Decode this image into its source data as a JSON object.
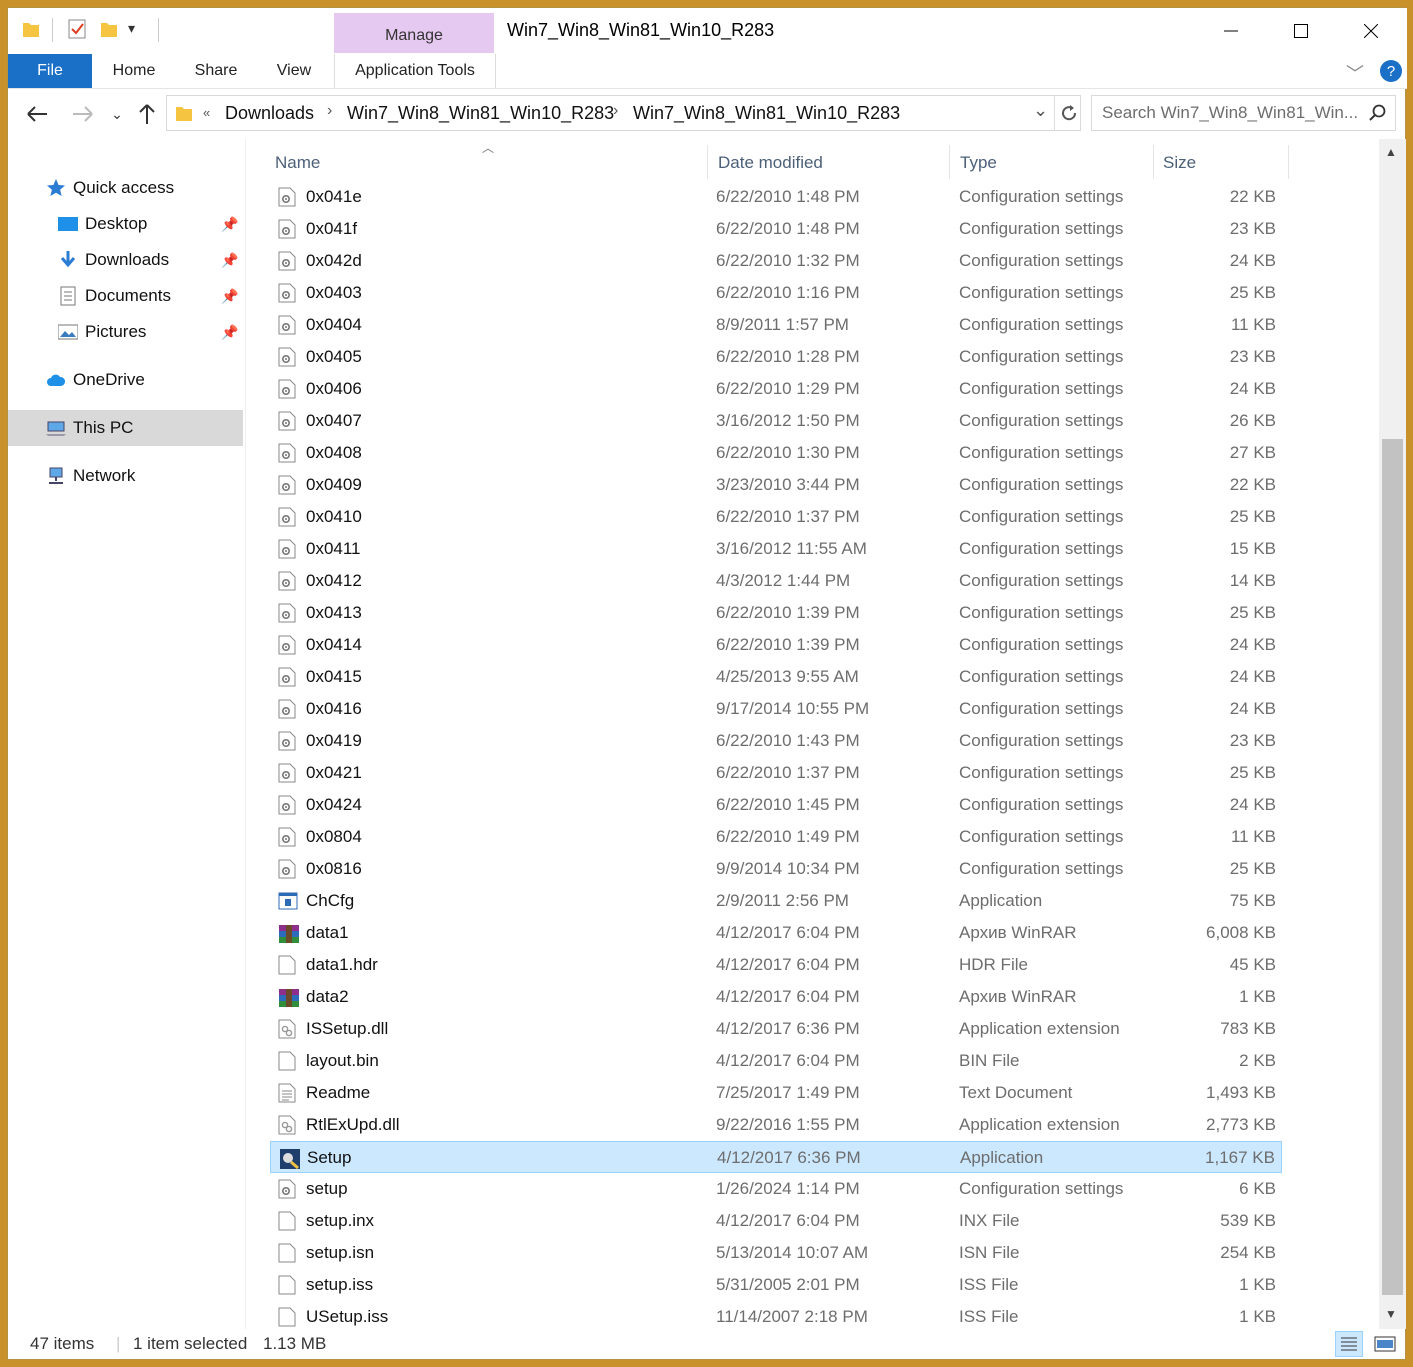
{
  "window": {
    "title": "Win7_Win8_Win81_Win10_R283",
    "manage_label": "Manage"
  },
  "ribbon": {
    "tabs": [
      "File",
      "Home",
      "Share",
      "View",
      "Application Tools"
    ]
  },
  "address": {
    "crumbs": [
      "Downloads",
      "Win7_Win8_Win81_Win10_R283",
      "Win7_Win8_Win81_Win10_R283"
    ],
    "overflow": "«"
  },
  "search": {
    "placeholder": "Search Win7_Win8_Win81_Win..."
  },
  "nav": {
    "quick_access": "Quick access",
    "pinned": [
      "Desktop",
      "Downloads",
      "Documents",
      "Pictures"
    ],
    "onedrive": "OneDrive",
    "thispc": "This PC",
    "network": "Network"
  },
  "columns": {
    "name": "Name",
    "date": "Date modified",
    "type": "Type",
    "size": "Size"
  },
  "files": [
    {
      "name": "0x041e",
      "date": "6/22/2010 1:48 PM",
      "type": "Configuration settings",
      "size": "22 KB",
      "icon": "config"
    },
    {
      "name": "0x041f",
      "date": "6/22/2010 1:48 PM",
      "type": "Configuration settings",
      "size": "23 KB",
      "icon": "config"
    },
    {
      "name": "0x042d",
      "date": "6/22/2010 1:32 PM",
      "type": "Configuration settings",
      "size": "24 KB",
      "icon": "config"
    },
    {
      "name": "0x0403",
      "date": "6/22/2010 1:16 PM",
      "type": "Configuration settings",
      "size": "25 KB",
      "icon": "config"
    },
    {
      "name": "0x0404",
      "date": "8/9/2011 1:57 PM",
      "type": "Configuration settings",
      "size": "11 KB",
      "icon": "config"
    },
    {
      "name": "0x0405",
      "date": "6/22/2010 1:28 PM",
      "type": "Configuration settings",
      "size": "23 KB",
      "icon": "config"
    },
    {
      "name": "0x0406",
      "date": "6/22/2010 1:29 PM",
      "type": "Configuration settings",
      "size": "24 KB",
      "icon": "config"
    },
    {
      "name": "0x0407",
      "date": "3/16/2012 1:50 PM",
      "type": "Configuration settings",
      "size": "26 KB",
      "icon": "config"
    },
    {
      "name": "0x0408",
      "date": "6/22/2010 1:30 PM",
      "type": "Configuration settings",
      "size": "27 KB",
      "icon": "config"
    },
    {
      "name": "0x0409",
      "date": "3/23/2010 3:44 PM",
      "type": "Configuration settings",
      "size": "22 KB",
      "icon": "config"
    },
    {
      "name": "0x0410",
      "date": "6/22/2010 1:37 PM",
      "type": "Configuration settings",
      "size": "25 KB",
      "icon": "config"
    },
    {
      "name": "0x0411",
      "date": "3/16/2012 11:55 AM",
      "type": "Configuration settings",
      "size": "15 KB",
      "icon": "config"
    },
    {
      "name": "0x0412",
      "date": "4/3/2012 1:44 PM",
      "type": "Configuration settings",
      "size": "14 KB",
      "icon": "config"
    },
    {
      "name": "0x0413",
      "date": "6/22/2010 1:39 PM",
      "type": "Configuration settings",
      "size": "25 KB",
      "icon": "config"
    },
    {
      "name": "0x0414",
      "date": "6/22/2010 1:39 PM",
      "type": "Configuration settings",
      "size": "24 KB",
      "icon": "config"
    },
    {
      "name": "0x0415",
      "date": "4/25/2013 9:55 AM",
      "type": "Configuration settings",
      "size": "24 KB",
      "icon": "config"
    },
    {
      "name": "0x0416",
      "date": "9/17/2014 10:55 PM",
      "type": "Configuration settings",
      "size": "24 KB",
      "icon": "config"
    },
    {
      "name": "0x0419",
      "date": "6/22/2010 1:43 PM",
      "type": "Configuration settings",
      "size": "23 KB",
      "icon": "config"
    },
    {
      "name": "0x0421",
      "date": "6/22/2010 1:37 PM",
      "type": "Configuration settings",
      "size": "25 KB",
      "icon": "config"
    },
    {
      "name": "0x0424",
      "date": "6/22/2010 1:45 PM",
      "type": "Configuration settings",
      "size": "24 KB",
      "icon": "config"
    },
    {
      "name": "0x0804",
      "date": "6/22/2010 1:49 PM",
      "type": "Configuration settings",
      "size": "11 KB",
      "icon": "config"
    },
    {
      "name": "0x0816",
      "date": "9/9/2014 10:34 PM",
      "type": "Configuration settings",
      "size": "25 KB",
      "icon": "config"
    },
    {
      "name": "ChCfg",
      "date": "2/9/2011 2:56 PM",
      "type": "Application",
      "size": "75 KB",
      "icon": "app"
    },
    {
      "name": "data1",
      "date": "4/12/2017 6:04 PM",
      "type": "Архив WinRAR",
      "size": "6,008 KB",
      "icon": "rar"
    },
    {
      "name": "data1.hdr",
      "date": "4/12/2017 6:04 PM",
      "type": "HDR File",
      "size": "45 KB",
      "icon": "blank"
    },
    {
      "name": "data2",
      "date": "4/12/2017 6:04 PM",
      "type": "Архив WinRAR",
      "size": "1 KB",
      "icon": "rar"
    },
    {
      "name": "ISSetup.dll",
      "date": "4/12/2017 6:36 PM",
      "type": "Application extension",
      "size": "783 KB",
      "icon": "dll"
    },
    {
      "name": "layout.bin",
      "date": "4/12/2017 6:04 PM",
      "type": "BIN File",
      "size": "2 KB",
      "icon": "blank"
    },
    {
      "name": "Readme",
      "date": "7/25/2017 1:49 PM",
      "type": "Text Document",
      "size": "1,493 KB",
      "icon": "text"
    },
    {
      "name": "RtlExUpd.dll",
      "date": "9/22/2016 1:55 PM",
      "type": "Application extension",
      "size": "2,773 KB",
      "icon": "dll"
    },
    {
      "name": "Setup",
      "date": "4/12/2017 6:36 PM",
      "type": "Application",
      "size": "1,167 KB",
      "icon": "setup",
      "selected": true
    },
    {
      "name": "setup",
      "date": "1/26/2024 1:14 PM",
      "type": "Configuration settings",
      "size": "6 KB",
      "icon": "config"
    },
    {
      "name": "setup.inx",
      "date": "4/12/2017 6:04 PM",
      "type": "INX File",
      "size": "539 KB",
      "icon": "blank"
    },
    {
      "name": "setup.isn",
      "date": "5/13/2014 10:07 AM",
      "type": "ISN File",
      "size": "254 KB",
      "icon": "blank"
    },
    {
      "name": "setup.iss",
      "date": "5/31/2005 2:01 PM",
      "type": "ISS File",
      "size": "1 KB",
      "icon": "blank"
    },
    {
      "name": "USetup.iss",
      "date": "11/14/2007 2:18 PM",
      "type": "ISS File",
      "size": "1 KB",
      "icon": "blank"
    }
  ],
  "status": {
    "items": "47 items",
    "selected": "1 item selected",
    "size": "1.13 MB"
  },
  "colors": {
    "accent": "#1a6fc7",
    "selection": "#cce8ff",
    "manage_tab": "#e6c9f0"
  }
}
